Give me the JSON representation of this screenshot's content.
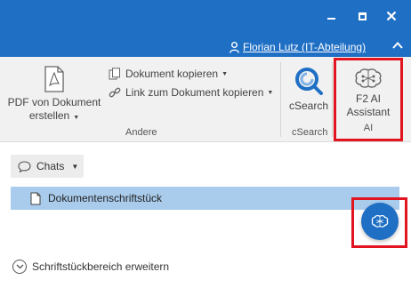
{
  "titlebar": {
    "user_name": "Florian Lutz (IT-Abteilung)"
  },
  "ribbon": {
    "pdf_button_line1": "PDF von Dokument",
    "pdf_button_line2": "erstellen",
    "copy_label": "Dokument kopieren",
    "link_label": "Link zum Dokument kopieren",
    "group_andere": "Andere",
    "csearch_label": "cSearch",
    "group_csearch": "cSearch",
    "ai_line1": "F2 AI",
    "ai_line2": "Assistant",
    "group_ai": "AI"
  },
  "content": {
    "chats_label": "Chats",
    "document_row": "Dokumentenschriftstück",
    "expand_label": "Schriftstückbereich erweitern"
  },
  "colors": {
    "titlebar": "#1f6fc5",
    "selection": "#a9cbec",
    "highlight": "#e2141f",
    "csearch_icon": "#1f6fc5"
  }
}
